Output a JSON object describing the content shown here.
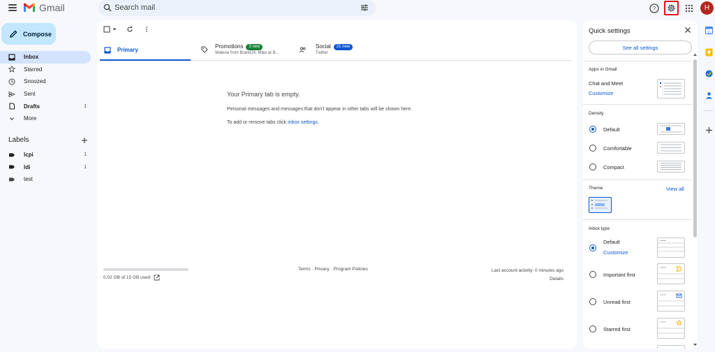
{
  "header": {
    "app_name": "Gmail",
    "search_placeholder": "Search mail",
    "avatar_letter": "H"
  },
  "sidebar": {
    "compose_label": "Compose",
    "items": [
      {
        "label": "Inbox",
        "count": "",
        "icon": "inbox-icon"
      },
      {
        "label": "Starred",
        "count": "",
        "icon": "star-icon"
      },
      {
        "label": "Snoozed",
        "count": "",
        "icon": "clock-icon"
      },
      {
        "label": "Sent",
        "count": "",
        "icon": "send-icon"
      },
      {
        "label": "Drafts",
        "count": "1",
        "icon": "draft-icon"
      },
      {
        "label": "More",
        "count": "",
        "icon": "chevron-down-icon"
      }
    ],
    "labels_title": "Labels",
    "labels": [
      {
        "label": "lcpi",
        "count": "1"
      },
      {
        "label": "ldi",
        "count": "1"
      },
      {
        "label": "test",
        "count": ""
      }
    ]
  },
  "tabs": {
    "primary": "Primary",
    "promotions": {
      "title": "Promotions",
      "badge": "3 new",
      "sub": "Waleria from Brand24, Mike at B...",
      "badge_color": "#188038"
    },
    "social": {
      "title": "Social",
      "badge": "21 new",
      "sub": "Twitter",
      "badge_color": "#0b57d0"
    }
  },
  "empty": {
    "title": "Your Primary tab is empty.",
    "line1": "Personal messages and messages that don't appear in other tabs will be shown here.",
    "line2_prefix": "To add or remove tabs click ",
    "line2_link": "inbox settings",
    "line2_suffix": "."
  },
  "footer": {
    "storage": "0.02 GB of 15 GB used",
    "terms": "Terms",
    "privacy": "Privacy",
    "policies": "Program Policies",
    "sep": " · ",
    "activity": "Last account activity: 0 minutes ago",
    "details": "Details"
  },
  "quick_settings": {
    "title": "Quick settings",
    "see_all": "See all settings",
    "apps_title": "Apps in Gmail",
    "apps_item": "Chat and Meet",
    "customize": "Customize",
    "density_title": "Density",
    "density_options": [
      "Default",
      "Comfortable",
      "Compact"
    ],
    "theme_title": "Theme",
    "view_all": "View all",
    "inbox_type_title": "Inbox type",
    "inbox_options": [
      "Default",
      "Important first",
      "Unread first",
      "Starred first"
    ]
  },
  "colors": {
    "accent": "#0b57d0",
    "gear_highlight": "#e3131b"
  }
}
